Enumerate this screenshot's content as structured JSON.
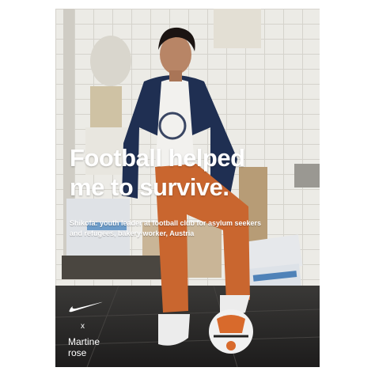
{
  "headline": {
    "line1": "Football helped",
    "line2": "me to survive."
  },
  "caption": {
    "line1": "Shikofa: youth leader at football club for asylum seekers",
    "line2": "and refugees, bakery worker, Austria"
  },
  "brand": {
    "logo_icon": "swoosh-icon",
    "separator": "x",
    "collaborator_line1": "Martine",
    "collaborator_line2": "rose"
  },
  "colors": {
    "tile_wall": "#ecebe6",
    "jacket": "#1f2f52",
    "trousers": "#c9662f",
    "floor": "#2c2b2b",
    "text": "#ffffff"
  }
}
